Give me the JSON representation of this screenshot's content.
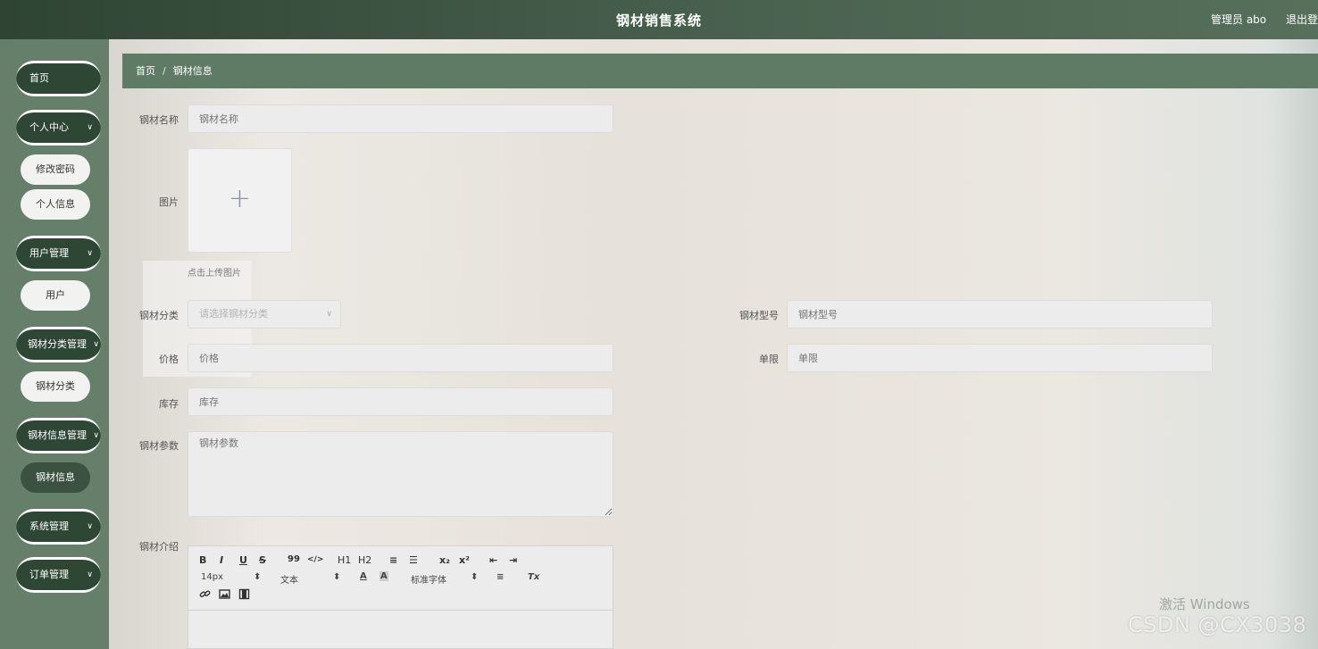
{
  "header": {
    "title": "钢材销售系统",
    "user": "管理员 abo",
    "logout": "退出登"
  },
  "sidebar": {
    "home": "首页",
    "personal": "个人中心",
    "change_pwd": "修改密码",
    "personal_info": "个人信息",
    "user_mgmt": "用户管理",
    "user": "用户",
    "cat_mgmt": "钢材分类管理",
    "cat": "钢材分类",
    "info_mgmt": "钢材信息管理",
    "info": "钢材信息",
    "sys_mgmt": "系统管理",
    "order_mgmt": "订单管理"
  },
  "breadcrumb": {
    "home": "首页",
    "sep": "/",
    "current": "钢材信息"
  },
  "form": {
    "name": {
      "label": "钢材名称",
      "placeholder": "钢材名称"
    },
    "image": {
      "label": "图片",
      "plus": "+",
      "hint": "点击上传图片"
    },
    "category": {
      "label": "钢材分类",
      "placeholder": "请选择钢材分类"
    },
    "model": {
      "label": "钢材型号",
      "placeholder": "钢材型号"
    },
    "price": {
      "label": "价格",
      "placeholder": "价格"
    },
    "limit": {
      "label": "单限",
      "placeholder": "单限"
    },
    "stock": {
      "label": "库存",
      "placeholder": "库存"
    },
    "params": {
      "label": "钢材参数",
      "placeholder": "钢材参数"
    },
    "intro": {
      "label": "钢材介绍"
    }
  },
  "editor": {
    "row1": [
      "B",
      "I",
      "U",
      "S",
      "99",
      "</>",
      "H1",
      "H2",
      "≡",
      "☰",
      "x₂",
      "x²",
      "⇤",
      "⇥"
    ],
    "size": "14px",
    "text_type": "文本",
    "font": "标准字体",
    "updown": "⬍",
    "color": "A",
    "bg": "A",
    "align": "≡",
    "clear": "Tx"
  },
  "watermark": {
    "activate": "激活 Windows",
    "csdn": "CSDN @CX3038"
  }
}
